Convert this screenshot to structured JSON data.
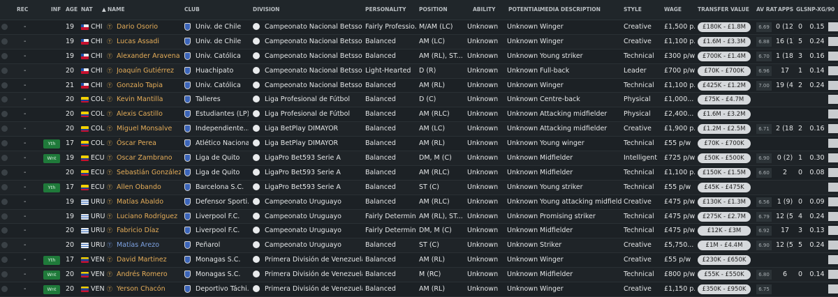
{
  "headers": {
    "rec": "REC",
    "inf": "INF",
    "age": "AGE",
    "nat": "NAT",
    "name": "NAME",
    "club": "CLUB",
    "division": "DIVISION",
    "personality": "PERSONALITY",
    "position": "POSITION",
    "ability": "ABILITY",
    "potential": "POTENTIAL",
    "media": "MEDIA DESCRIPTION",
    "style": "STYLE",
    "wage": "WAGE",
    "transfer": "TRANSFER VALUE",
    "avrat": "AV RAT",
    "apps": "APPS",
    "gls": "GLS",
    "npxg": "NP-XG/90",
    "sort_icon": "▲"
  },
  "rows": [
    {
      "rec": "-",
      "inf": "",
      "age": "19",
      "flag": "chi",
      "nat": "CHI",
      "name": "Dario Osorio",
      "club": "Univ. de Chile",
      "division": "Campeonato Nacional Betsson",
      "personality": "Fairly Professio...",
      "position": "M/AM (LC)",
      "ability": "Unknown",
      "potential": "Unknown",
      "media": "Winger",
      "style": "Creative",
      "wage": "£1,500 p...",
      "tv": "£180K - £1.8M",
      "avrat": "6.69",
      "apps": "0 (12)",
      "gls": "0",
      "npxg": "0.15"
    },
    {
      "rec": "-",
      "inf": "",
      "age": "19",
      "flag": "chi",
      "nat": "CHI",
      "name": "Lucas Assadi",
      "club": "Univ. de Chile",
      "division": "Campeonato Nacional Betsson",
      "personality": "Balanced",
      "position": "AM (LC)",
      "ability": "Unknown",
      "potential": "Unknown",
      "media": "Winger",
      "style": "Creative",
      "wage": "£1,100 p...",
      "tv": "£1.6M - £3.3M",
      "avrat": "6.88",
      "apps": "16 (1)",
      "gls": "5",
      "npxg": "0.24"
    },
    {
      "rec": "-",
      "inf": "",
      "age": "19",
      "flag": "chi",
      "nat": "CHI",
      "name": "Alexander Aravena",
      "club": "Univ. Católica",
      "division": "Campeonato Nacional Betsson",
      "personality": "Balanced",
      "position": "AM (RL), ST...",
      "ability": "Unknown",
      "potential": "Unknown",
      "media": "Young striker",
      "style": "Technical",
      "wage": "£300 p/w",
      "tv": "£700K - £1.4M",
      "avrat": "6.70",
      "apps": "1 (18)",
      "gls": "3",
      "npxg": "0.16"
    },
    {
      "rec": "-",
      "inf": "",
      "age": "20",
      "flag": "chi",
      "nat": "CHI",
      "name": "Joaquín Gutiérrez",
      "club": "Huachipato",
      "division": "Campeonato Nacional Betsson",
      "personality": "Light-Hearted",
      "position": "D (R)",
      "ability": "Unknown",
      "potential": "Unknown",
      "media": "Full-back",
      "style": "Leader",
      "wage": "£700 p/w",
      "tv": "£70K - £700K",
      "avrat": "6.96",
      "apps": "17",
      "gls": "1",
      "npxg": "0.14"
    },
    {
      "rec": "-",
      "inf": "",
      "age": "21",
      "flag": "chi",
      "nat": "CHI",
      "name": "Gonzalo Tapia",
      "club": "Univ. Católica",
      "division": "Campeonato Nacional Betsson",
      "personality": "Balanced",
      "position": "AM (RL)",
      "ability": "Unknown",
      "potential": "Unknown",
      "media": "Winger",
      "style": "Technical",
      "wage": "£1,100 p...",
      "tv": "£425K - £1.2M",
      "avrat": "7.00",
      "apps": "19 (4)",
      "gls": "2",
      "npxg": "0.24"
    },
    {
      "rec": "-",
      "inf": "",
      "age": "20",
      "flag": "col",
      "nat": "COL",
      "name": "Kevin Mantilla",
      "club": "Talleres",
      "division": "Liga Profesional de Fútbol",
      "personality": "Balanced",
      "position": "D (C)",
      "ability": "Unknown",
      "potential": "Unknown",
      "media": "Centre-back",
      "style": "Physical",
      "wage": "£1,000...",
      "tv": "£75K - £4.7M",
      "avrat": "",
      "apps": "",
      "gls": "",
      "npxg": ""
    },
    {
      "rec": "-",
      "inf": "",
      "age": "20",
      "flag": "col",
      "nat": "COL",
      "name": "Alexis Castillo",
      "club": "Estudiantes (LP)",
      "division": "Liga Profesional de Fútbol",
      "personality": "Balanced",
      "position": "AM (RLC)",
      "ability": "Unknown",
      "potential": "Unknown",
      "media": "Attacking midfielder",
      "style": "Physical",
      "wage": "£2,400...",
      "tv": "£1.6M - £3.2M",
      "avrat": "",
      "apps": "",
      "gls": "",
      "npxg": ""
    },
    {
      "rec": "-",
      "inf": "",
      "age": "20",
      "flag": "col",
      "nat": "COL",
      "name": "Miguel Monsalve",
      "club": "Independiente...",
      "division": "Liga BetPlay DIMAYOR",
      "personality": "Balanced",
      "position": "AM (LC)",
      "ability": "Unknown",
      "potential": "Unknown",
      "media": "Attacking midfielder",
      "style": "Creative",
      "wage": "£1,900 p...",
      "tv": "£1.2M - £2.5M",
      "avrat": "6.71",
      "apps": "2 (18)",
      "gls": "2",
      "npxg": "0.16"
    },
    {
      "rec": "-",
      "inf": "Yth",
      "age": "17",
      "flag": "col",
      "nat": "COL",
      "name": "Óscar Perea",
      "club": "Atlético Nacional",
      "division": "Liga BetPlay DIMAYOR",
      "personality": "Balanced",
      "position": "AM (RL)",
      "ability": "Unknown",
      "potential": "Unknown",
      "media": "Young winger",
      "style": "Technical",
      "wage": "£55 p/w",
      "tv": "£70K - £700K",
      "avrat": "",
      "apps": "",
      "gls": "",
      "npxg": ""
    },
    {
      "rec": "-",
      "inf": "Wnt",
      "age": "19",
      "flag": "ecu",
      "nat": "ECU",
      "name": "Oscar Zambrano",
      "club": "Liga de Quito",
      "division": "LigaPro Bet593 Serie A",
      "personality": "Balanced",
      "position": "DM, M (C)",
      "ability": "Unknown",
      "potential": "Unknown",
      "media": "Midfielder",
      "style": "Intelligent",
      "wage": "£725 p/w",
      "tv": "£50K - £500K",
      "avrat": "6.90",
      "apps": "0 (2)",
      "gls": "1",
      "npxg": "0.30"
    },
    {
      "rec": "-",
      "inf": "",
      "age": "20",
      "flag": "ecu",
      "nat": "ECU",
      "name": "Sebastián González",
      "club": "Liga de Quito",
      "division": "LigaPro Bet593 Serie A",
      "personality": "Balanced",
      "position": "AM (RLC)",
      "ability": "Unknown",
      "potential": "Unknown",
      "media": "Midfielder",
      "style": "Technical",
      "wage": "£1,100 p...",
      "tv": "£150K - £1.5M",
      "avrat": "6.60",
      "apps": "2",
      "gls": "0",
      "npxg": "0.08"
    },
    {
      "rec": "-",
      "inf": "Yth",
      "age": "17",
      "flag": "ecu",
      "nat": "ECU",
      "name": "Allen Obando",
      "club": "Barcelona S.C.",
      "division": "LigaPro Bet593 Serie A",
      "personality": "Balanced",
      "position": "ST (C)",
      "ability": "Unknown",
      "potential": "Unknown",
      "media": "Young striker",
      "style": "Technical",
      "wage": "£55 p/w",
      "tv": "£45K - £475K",
      "avrat": "",
      "apps": "",
      "gls": "",
      "npxg": ""
    },
    {
      "rec": "-",
      "inf": "",
      "age": "19",
      "flag": "uru",
      "nat": "URU",
      "name": "Matías Abaldo",
      "club": "Defensor Sporti...",
      "division": "Campeonato Uruguayo",
      "personality": "Balanced",
      "position": "AM (RLC)",
      "ability": "Unknown",
      "potential": "Unknown",
      "media": "Young attacking midfielder",
      "style": "Creative",
      "wage": "£475 p/w",
      "tv": "£130K - £1.3M",
      "avrat": "6.56",
      "apps": "1 (9)",
      "gls": "0",
      "npxg": "0.09"
    },
    {
      "rec": "-",
      "inf": "",
      "age": "19",
      "flag": "uru",
      "nat": "URU",
      "name": "Luciano Rodríguez",
      "club": "Liverpool F.C.",
      "division": "Campeonato Uruguayo",
      "personality": "Fairly Determin...",
      "position": "AM (RL), ST...",
      "ability": "Unknown",
      "potential": "Unknown",
      "media": "Promising striker",
      "style": "Technical",
      "wage": "£475 p/w",
      "tv": "£275K - £2.7M",
      "avrat": "6.79",
      "apps": "12 (5)",
      "gls": "4",
      "npxg": "0.24"
    },
    {
      "rec": "-",
      "inf": "",
      "age": "20",
      "flag": "uru",
      "nat": "URU",
      "name": "Fabricio Díaz",
      "club": "Liverpool F.C.",
      "division": "Campeonato Uruguayo",
      "personality": "Fairly Determin...",
      "position": "DM, M (C)",
      "ability": "Unknown",
      "potential": "Unknown",
      "media": "Midfielder",
      "style": "Technical",
      "wage": "£475 p/w",
      "tv": "£12K - £3M",
      "avrat": "6.92",
      "apps": "17",
      "gls": "3",
      "npxg": "0.13"
    },
    {
      "rec": "-",
      "inf": "",
      "age": "20",
      "flag": "uru",
      "nat": "URU",
      "name": "Matías Arezo",
      "club": "Peñarol",
      "division": "Campeonato Uruguayo",
      "personality": "Balanced",
      "position": "ST (C)",
      "ability": "Unknown",
      "potential": "Unknown",
      "media": "Striker",
      "style": "Creative",
      "wage": "£5,750...",
      "tv": "£1M - £4.4M",
      "avrat": "6.90",
      "apps": "12 (5)",
      "gls": "5",
      "npxg": "0.24",
      "blue": true
    },
    {
      "rec": "-",
      "inf": "Yth",
      "age": "17",
      "flag": "ven",
      "nat": "VEN",
      "name": "David Martinez",
      "club": "Monagas S.C.",
      "division": "Primera División de Venezuela",
      "personality": "Balanced",
      "position": "AM (RL)",
      "ability": "Unknown",
      "potential": "Unknown",
      "media": "Winger",
      "style": "Creative",
      "wage": "£55 p/w",
      "tv": "£230K - £650K",
      "avrat": "",
      "apps": "",
      "gls": "",
      "npxg": ""
    },
    {
      "rec": "-",
      "inf": "Wnt",
      "age": "20",
      "flag": "ven",
      "nat": "VEN",
      "name": "Andrés Romero",
      "club": "Monagas S.C.",
      "division": "Primera División de Venezuela",
      "personality": "Balanced",
      "position": "M (RC)",
      "ability": "Unknown",
      "potential": "Unknown",
      "media": "Midfielder",
      "style": "Technical",
      "wage": "£800 p/w",
      "tv": "£55K - £550K",
      "avrat": "6.80",
      "apps": "6",
      "gls": "0",
      "npxg": "0.14"
    },
    {
      "rec": "-",
      "inf": "Wnt",
      "age": "20",
      "flag": "ven",
      "nat": "VEN",
      "name": "Yerson Chacón",
      "club": "Deportivo Táchi...",
      "division": "Primera División de Venezuela",
      "personality": "Balanced",
      "position": "AM (RL)",
      "ability": "Unknown",
      "potential": "Unknown",
      "media": "Winger",
      "style": "Creative",
      "wage": "£1,150 p...",
      "tv": "£350K - £950K",
      "avrat": "6.75",
      "apps": "",
      "gls": "",
      "npxg": ""
    }
  ]
}
